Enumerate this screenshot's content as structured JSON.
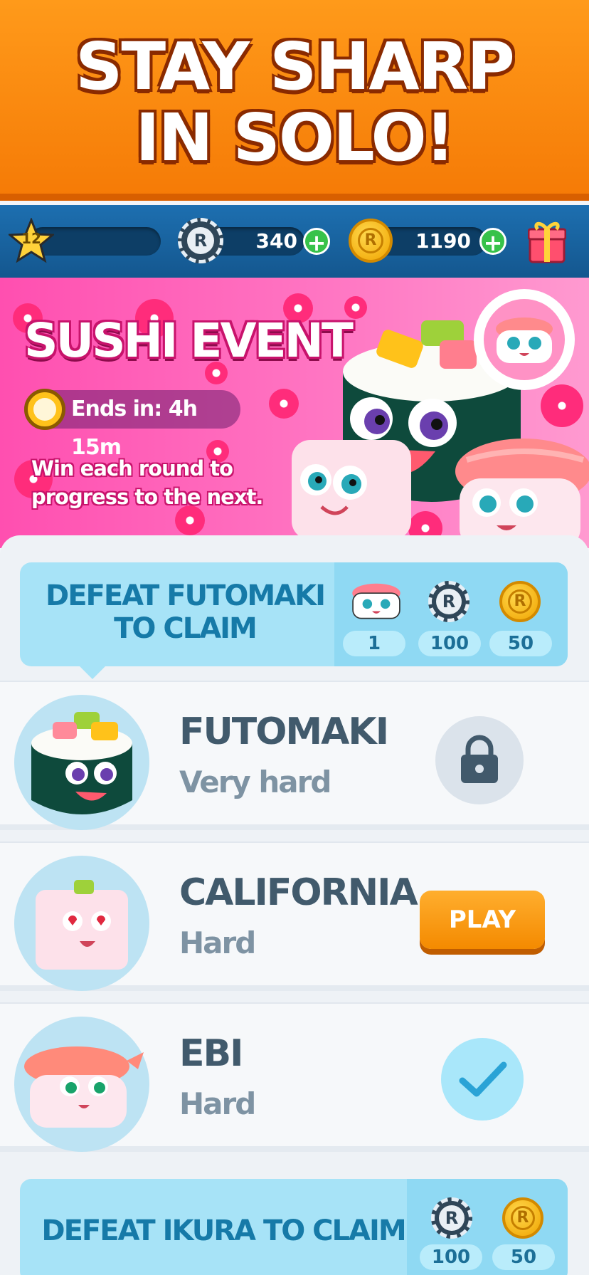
{
  "promo": {
    "line1": "STAY SHARP",
    "line2": "IN SOLO!"
  },
  "topbar": {
    "level": "12",
    "chips": "340",
    "coins": "1190",
    "chip_symbol": "R",
    "coin_symbol": "R",
    "plus": "+"
  },
  "event": {
    "title": "SUSHI EVENT",
    "timer": "Ends in: 4h 15m",
    "description": "Win each round to progress to the next."
  },
  "claim1": {
    "text": "DEFEAT FUTOMAKI TO CLAIM",
    "rewards": [
      {
        "icon": "sushi-icon",
        "value": "1"
      },
      {
        "icon": "chip-icon",
        "value": "100"
      },
      {
        "icon": "coin-icon",
        "value": "50"
      }
    ]
  },
  "opponents": [
    {
      "name": "FUTOMAKI",
      "difficulty": "Very hard",
      "state": "locked"
    },
    {
      "name": "CALIFORNIA",
      "difficulty": "Hard",
      "state": "play",
      "action_label": "PLAY"
    },
    {
      "name": "EBI",
      "difficulty": "Hard",
      "state": "completed"
    }
  ],
  "claim2": {
    "text": "DEFEAT IKURA TO CLAIM",
    "rewards": [
      {
        "icon": "chip-icon",
        "value": "100"
      },
      {
        "icon": "coin-icon",
        "value": "50"
      }
    ]
  },
  "colors": {
    "accent": "#f48a00",
    "event_pink": "#ff4fb0",
    "bar_blue": "#1d6fb0",
    "claim_blue": "#a7e3f7"
  }
}
